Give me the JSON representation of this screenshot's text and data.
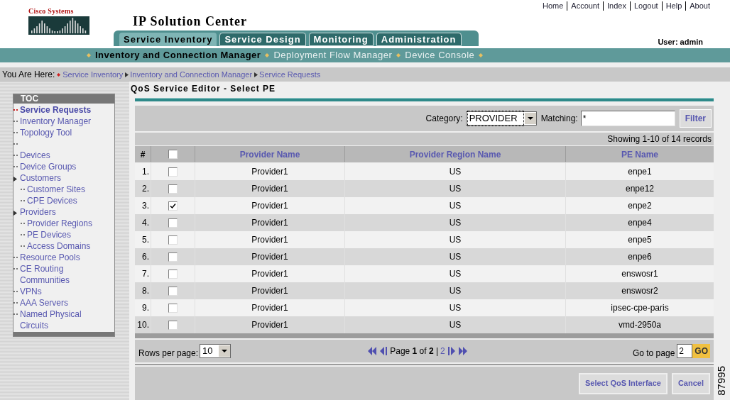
{
  "header": {
    "logo_text": "Cisco Systems",
    "title": "IP Solution Center",
    "top_links": [
      "Home",
      "Account",
      "Index",
      "Logout",
      "Help",
      "About"
    ],
    "user": "User: admin"
  },
  "tabs": [
    {
      "label": "Service Inventory",
      "selected": true
    },
    {
      "label": "Service Design",
      "selected": false
    },
    {
      "label": "Monitoring",
      "selected": false
    },
    {
      "label": "Administration",
      "selected": false
    }
  ],
  "subnav": [
    {
      "label": "Inventory and Connection Manager",
      "selected": true
    },
    {
      "label": "Deployment Flow Manager",
      "selected": false
    },
    {
      "label": "Device Console",
      "selected": false
    }
  ],
  "breadcrumb": {
    "label": "You Are Here:",
    "items": [
      "Service Inventory",
      "Inventory and Connection Manager",
      "Service Requests"
    ]
  },
  "toc": {
    "title": "TOC",
    "items": [
      {
        "kind": "link",
        "label": "Service Requests",
        "selected": true
      },
      {
        "kind": "link",
        "label": "Inventory Manager",
        "selected": false
      },
      {
        "kind": "link",
        "label": "Topology Tool",
        "selected": false
      },
      {
        "kind": "blank"
      },
      {
        "kind": "link",
        "label": "Devices",
        "selected": false
      },
      {
        "kind": "link",
        "label": "Device Groups",
        "selected": false
      },
      {
        "kind": "group",
        "label": "Customers",
        "selected": false,
        "children": [
          {
            "label": "Customer Sites",
            "selected": false
          },
          {
            "label": "CPE Devices",
            "selected": false
          }
        ]
      },
      {
        "kind": "group",
        "label": "Providers",
        "selected": false,
        "children": [
          {
            "label": "Provider Regions",
            "selected": false
          },
          {
            "label": "PE Devices",
            "selected": false
          },
          {
            "label": "Access Domains",
            "selected": false
          }
        ]
      },
      {
        "kind": "link",
        "label": "Resource Pools",
        "selected": false
      },
      {
        "kind": "link",
        "label": "CE Routing Communities",
        "selected": false
      },
      {
        "kind": "link",
        "label": "VPNs",
        "selected": false
      },
      {
        "kind": "link",
        "label": "AAA Servers",
        "selected": false
      },
      {
        "kind": "link",
        "label": "Named Physical Circuits",
        "selected": false
      }
    ]
  },
  "page_title": "QoS Service Editor - Select PE",
  "filter": {
    "category_label": "Category:",
    "category_value": "PROVIDER",
    "matching_label": "Matching:",
    "matching_value": "*",
    "button": "Filter"
  },
  "records": "Showing 1-10 of 14 records",
  "table": {
    "columns": [
      "#",
      "Provider Name",
      "Provider Region Name",
      "PE Name"
    ],
    "select_all_checked": false,
    "rows": [
      {
        "num": "1.",
        "checked": false,
        "provider": "Provider1",
        "region": "US",
        "pe": "enpe1"
      },
      {
        "num": "2.",
        "checked": false,
        "provider": "Provider1",
        "region": "US",
        "pe": "enpe12"
      },
      {
        "num": "3.",
        "checked": true,
        "provider": "Provider1",
        "region": "US",
        "pe": "enpe2"
      },
      {
        "num": "4.",
        "checked": false,
        "provider": "Provider1",
        "region": "US",
        "pe": "enpe4"
      },
      {
        "num": "5.",
        "checked": false,
        "provider": "Provider1",
        "region": "US",
        "pe": "enpe5"
      },
      {
        "num": "6.",
        "checked": false,
        "provider": "Provider1",
        "region": "US",
        "pe": "enpe6"
      },
      {
        "num": "7.",
        "checked": false,
        "provider": "Provider1",
        "region": "US",
        "pe": "enswosr1"
      },
      {
        "num": "8.",
        "checked": false,
        "provider": "Provider1",
        "region": "US",
        "pe": "enswosr2"
      },
      {
        "num": "9.",
        "checked": false,
        "provider": "Provider1",
        "region": "US",
        "pe": "ipsec-cpe-paris"
      },
      {
        "num": "10.",
        "checked": false,
        "provider": "Provider1",
        "region": "US",
        "pe": "vmd-2950a"
      }
    ]
  },
  "pagination": {
    "rows_label": "Rows per page:",
    "rows_value": "10",
    "page_text": "Page **1** of **2** |",
    "page_link": "2",
    "goto_label": "Go to page",
    "goto_value": "2",
    "go_button": "GO"
  },
  "actions": [
    "Select QoS Interface",
    "Cancel"
  ],
  "figure_number": "87995"
}
